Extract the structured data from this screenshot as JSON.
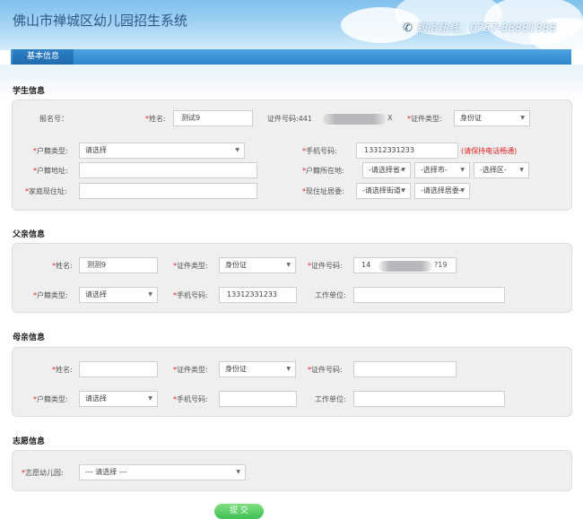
{
  "header": {
    "site_title": "佛山市禅城区幼儿园招生系统",
    "hotline": "服务热线：0757-88881888"
  },
  "tabs": [
    {
      "label": "基本信息"
    }
  ],
  "student": {
    "section_title": "学生信息",
    "reg_no_label": "报名号：",
    "name_label": "姓名:",
    "name_value": "测试9",
    "id_no_label": "证件号码:",
    "id_no_prefix": "441",
    "id_no_suffix": "X",
    "id_type_label": "证件类型:",
    "id_type_value": "身份证",
    "hukou_type_label": "户籍类型:",
    "hukou_type_value": "请选择",
    "phone_label": "手机号码:",
    "phone_value": "13312331233",
    "phone_note": "(请保持电话畅通)",
    "hukou_addr_label": "户籍地址:",
    "hukou_loc_label": "户籍所在地:",
    "province_value": "-请选择省-",
    "city_value": "-选择市-",
    "district_value": "-选择区-",
    "home_addr_label": "家庭现住址:",
    "residence_label": "现住址居委:",
    "residence_sel1": "-请选择街道-",
    "residence_sel2": "-请选择居委-"
  },
  "father": {
    "section_title": "父亲信息",
    "name_label": "姓名:",
    "name_value": "测测9",
    "id_type_label": "证件类型:",
    "id_type_value": "身份证",
    "id_no_label": "证件号码:",
    "id_no_prefix": "14",
    "id_no_suffix": "?19",
    "hukou_type_label": "户籍类型:",
    "hukou_type_value": "请选择",
    "phone_label": "手机号码:",
    "phone_value": "13312331233",
    "employer_label": "工作单位:"
  },
  "mother": {
    "section_title": "母亲信息",
    "name_label": "姓名:",
    "id_type_label": "证件类型:",
    "id_type_value": "身份证",
    "id_no_label": "证件号码:",
    "hukou_type_label": "户籍类型:",
    "hukou_type_value": "请选择",
    "phone_label": "手机号码:",
    "employer_label": "工作单位:"
  },
  "wish": {
    "section_title": "志愿信息",
    "kindergarten_label": "志愿幼儿园:",
    "kindergarten_value": "--- 请选择 ---"
  },
  "submit_label": "提 交",
  "colors": {
    "accent_blue": "#2d86cf",
    "required_red": "#e02020",
    "submit_green": "#3fbf55"
  }
}
